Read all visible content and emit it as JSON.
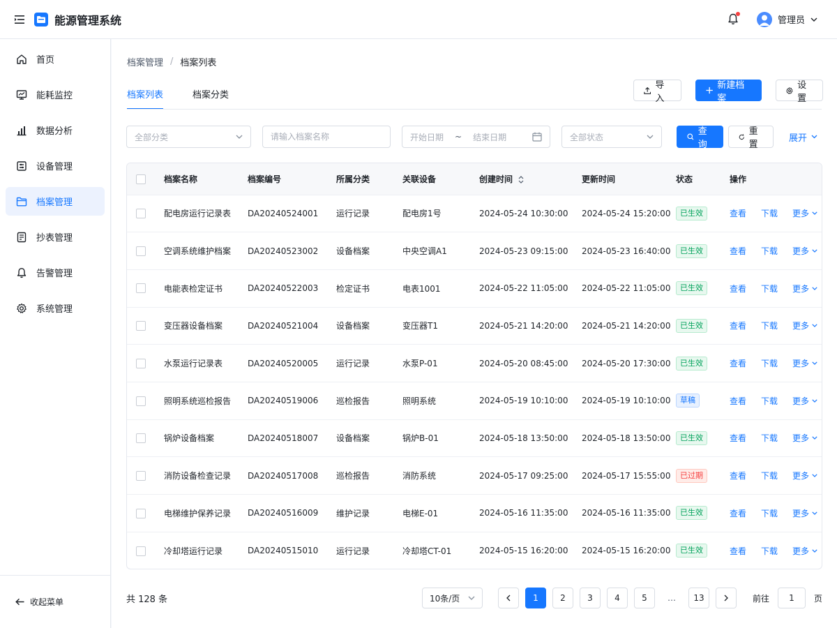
{
  "header": {
    "app_title": "能源管理系统",
    "user_name": "管理员",
    "has_notification": true
  },
  "sidebar": {
    "items": [
      {
        "label": "首页",
        "icon": "home-icon"
      },
      {
        "label": "能耗监控",
        "icon": "monitor-icon"
      },
      {
        "label": "数据分析",
        "icon": "bar-chart-icon"
      },
      {
        "label": "设备管理",
        "icon": "device-icon"
      },
      {
        "label": "档案管理",
        "icon": "folder-icon",
        "active": true
      },
      {
        "label": "抄表管理",
        "icon": "meter-icon"
      },
      {
        "label": "告警管理",
        "icon": "alarm-icon"
      },
      {
        "label": "系统管理",
        "icon": "settings-icon"
      }
    ],
    "collapse_label": "收起菜单"
  },
  "breadcrumb": {
    "parent": "档案管理",
    "separator": "/",
    "current": "档案列表"
  },
  "tabs": [
    {
      "label": "档案列表",
      "active": true
    },
    {
      "label": "档案分类",
      "active": false
    }
  ],
  "toolbar": {
    "import_label": "导入",
    "new_label": "新建档案",
    "settings_label": "设置"
  },
  "filters": {
    "category_placeholder": "全部分类",
    "name_placeholder": "请输入档案名称",
    "start_date_placeholder": "开始日期",
    "date_separator": "~",
    "end_date_placeholder": "结束日期",
    "status_placeholder": "全部状态",
    "query_label": "查询",
    "reset_label": "重置",
    "expand_label": "展开"
  },
  "table": {
    "headers": {
      "name": "档案名称",
      "code": "档案编号",
      "category": "所属分类",
      "device": "关联设备",
      "created": "创建时间",
      "updated": "更新时间",
      "status": "状态",
      "actions": "操作"
    },
    "action_labels": {
      "view": "查看",
      "download": "下载",
      "more": "更多"
    },
    "rows": [
      {
        "name": "配电房运行记录表",
        "code": "DA20240524001",
        "category": "运行记录",
        "device": "配电房1号",
        "created": "2024-05-24 10:30:00",
        "updated": "2024-05-24 15:20:00",
        "status": "已生效",
        "status_type": "green"
      },
      {
        "name": "空调系统维护档案",
        "code": "DA20240523002",
        "category": "设备档案",
        "device": "中央空调A1",
        "created": "2024-05-23 09:15:00",
        "updated": "2024-05-23 16:40:00",
        "status": "已生效",
        "status_type": "green"
      },
      {
        "name": "电能表检定证书",
        "code": "DA20240522003",
        "category": "检定证书",
        "device": "电表1001",
        "created": "2024-05-22 11:05:00",
        "updated": "2024-05-22 11:05:00",
        "status": "已生效",
        "status_type": "green"
      },
      {
        "name": "变压器设备档案",
        "code": "DA20240521004",
        "category": "设备档案",
        "device": "变压器T1",
        "created": "2024-05-21 14:20:00",
        "updated": "2024-05-21 14:20:00",
        "status": "已生效",
        "status_type": "green"
      },
      {
        "name": "水泵运行记录表",
        "code": "DA20240520005",
        "category": "运行记录",
        "device": "水泵P-01",
        "created": "2024-05-20 08:45:00",
        "updated": "2024-05-20 17:30:00",
        "status": "已生效",
        "status_type": "green"
      },
      {
        "name": "照明系统巡检报告",
        "code": "DA20240519006",
        "category": "巡检报告",
        "device": "照明系统",
        "created": "2024-05-19 10:10:00",
        "updated": "2024-05-19 10:10:00",
        "status": "草稿",
        "status_type": "blue"
      },
      {
        "name": "锅炉设备档案",
        "code": "DA20240518007",
        "category": "设备档案",
        "device": "锅炉B-01",
        "created": "2024-05-18 13:50:00",
        "updated": "2024-05-18 13:50:00",
        "status": "已生效",
        "status_type": "green"
      },
      {
        "name": "消防设备检查记录",
        "code": "DA20240517008",
        "category": "巡检报告",
        "device": "消防系统",
        "created": "2024-05-17 09:25:00",
        "updated": "2024-05-17 15:55:00",
        "status": "已过期",
        "status_type": "red"
      },
      {
        "name": "电梯维护保养记录",
        "code": "DA20240516009",
        "category": "维护记录",
        "device": "电梯E-01",
        "created": "2024-05-16 11:35:00",
        "updated": "2024-05-16 11:35:00",
        "status": "已生效",
        "status_type": "green"
      },
      {
        "name": "冷却塔运行记录",
        "code": "DA20240515010",
        "category": "运行记录",
        "device": "冷却塔CT-01",
        "created": "2024-05-15 16:20:00",
        "updated": "2024-05-15 16:20:00",
        "status": "已生效",
        "status_type": "green"
      }
    ]
  },
  "pagination": {
    "total_text": "共 128 条",
    "page_size": "10条/页",
    "pages": [
      "1",
      "2",
      "3",
      "4",
      "5",
      "…",
      "13"
    ],
    "current_page": "1",
    "goto_prefix": "前往",
    "goto_value": "1",
    "goto_suffix": "页"
  },
  "colors": {
    "primary": "#1677ff",
    "success": "#00a15a",
    "danger": "#f53f3f"
  }
}
